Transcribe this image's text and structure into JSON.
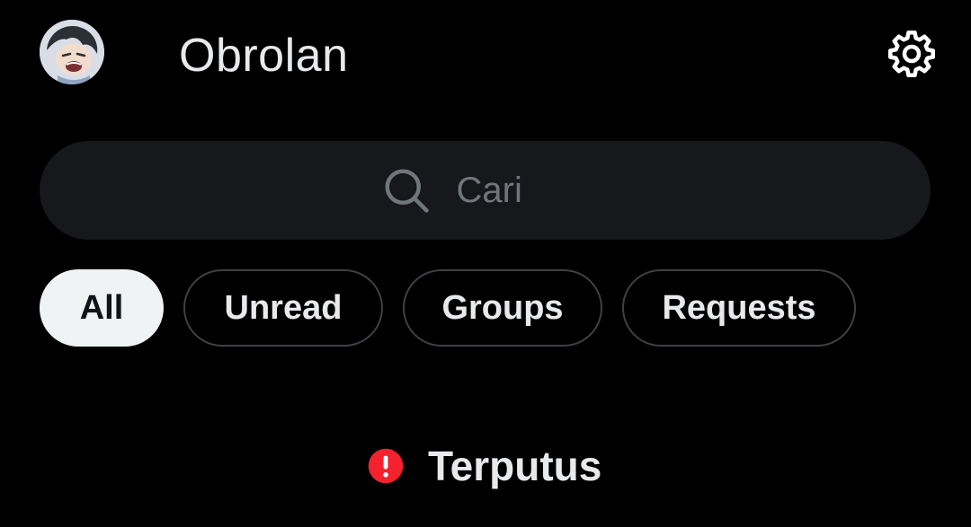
{
  "header": {
    "title": "Obrolan",
    "avatar_icon": "profile-avatar",
    "settings_icon": "gear-icon"
  },
  "search": {
    "placeholder": "Cari",
    "value": "",
    "icon": "search-icon"
  },
  "filters": {
    "selected": "All",
    "items": [
      {
        "label": "All"
      },
      {
        "label": "Unread"
      },
      {
        "label": "Groups"
      },
      {
        "label": "Requests"
      }
    ]
  },
  "status": {
    "text": "Terputus",
    "icon": "alert-icon",
    "color": "#f4212e"
  },
  "colors": {
    "background": "#000000",
    "search_bg": "#16181c",
    "chip_border": "#3e4144",
    "active_chip_bg": "#eff3f4",
    "text": "#e7e9ea",
    "muted": "#71767b"
  }
}
